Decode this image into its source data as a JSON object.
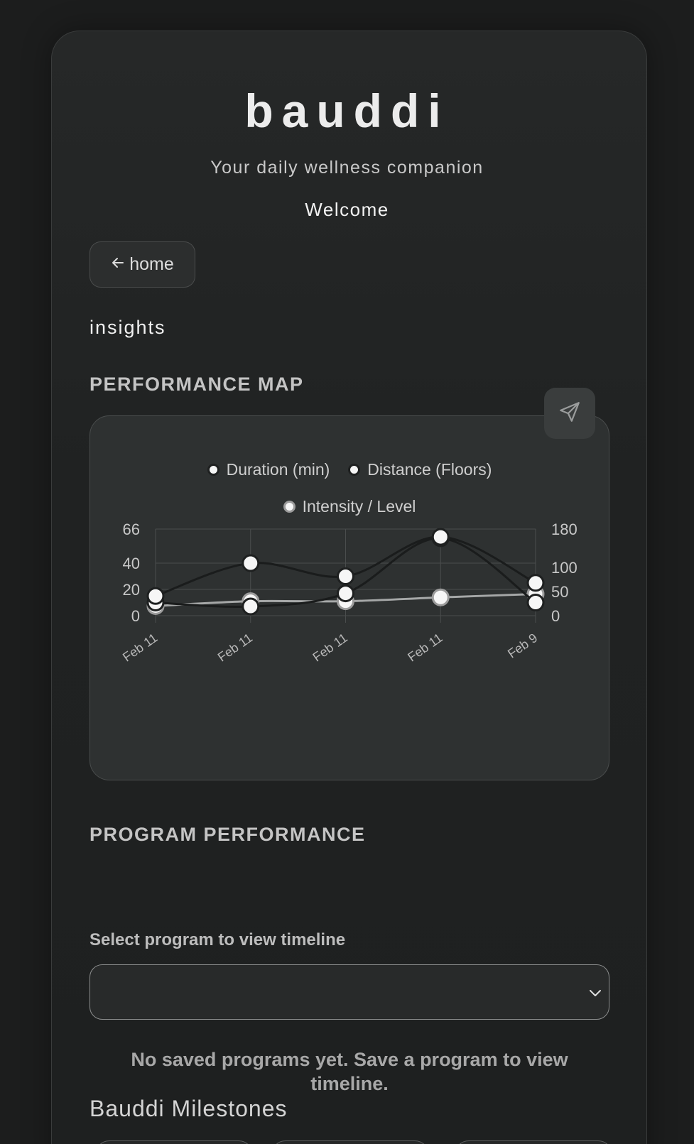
{
  "brand": {
    "name": "bauddi",
    "tagline": "Your daily wellness companion",
    "welcome": "Welcome"
  },
  "nav": {
    "home_label": "home",
    "back_icon": "arrow-left-icon"
  },
  "page": {
    "title": "insights"
  },
  "performance_map": {
    "heading": "PERFORMANCE MAP",
    "share_icon": "send-icon"
  },
  "chart_data": {
    "type": "line",
    "categories": [
      "Feb 11",
      "Feb 11",
      "Feb 11",
      "Feb 11",
      "Feb 9"
    ],
    "series": [
      {
        "name": "Duration (min)",
        "values": [
          15,
          40,
          30,
          60,
          25
        ],
        "axis": "left",
        "color": "#1e2020"
      },
      {
        "name": "Distance (Floors)",
        "values": [
          10,
          7,
          17,
          59,
          10
        ],
        "axis": "left",
        "color": "#1e2020"
      },
      {
        "name": "Intensity / Level",
        "values": [
          20,
          30,
          30,
          38,
          45
        ],
        "axis": "right",
        "color": "#9c9c9c"
      }
    ],
    "y_left": {
      "ticks": [
        0,
        20,
        40,
        66
      ],
      "range": [
        0,
        66
      ]
    },
    "y_right": {
      "ticks": [
        0,
        50,
        100,
        180
      ],
      "range": [
        0,
        180
      ]
    },
    "grid": true,
    "legend": "top-center"
  },
  "program_performance": {
    "heading": "PROGRAM PERFORMANCE",
    "select_label": "Select program to view timeline",
    "select_value": "",
    "select_icon": "chevron-down-icon",
    "empty_message": "No saved programs yet. Save a program to view timeline."
  },
  "milestones": {
    "heading": "Bauddi Milestones"
  },
  "colors": {
    "background": "#1c1d1d",
    "card": "#262828",
    "chart_panel": "#2e3131",
    "accent_grey": "#9c9c9c"
  }
}
